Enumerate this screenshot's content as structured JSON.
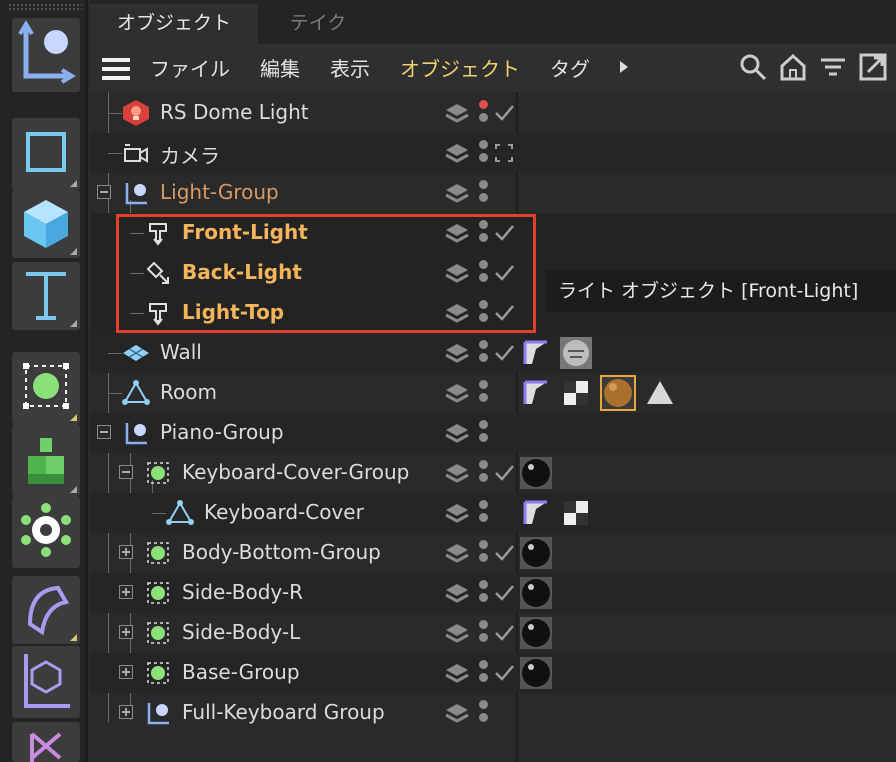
{
  "tabs": {
    "objects": "オブジェクト",
    "takes": "テイク"
  },
  "menu": {
    "file": "ファイル",
    "edit": "編集",
    "view": "表示",
    "object": "オブジェクト",
    "tag": "タグ"
  },
  "objects": [
    {
      "name": "RS Dome Light",
      "icon": "dome-light-icon"
    },
    {
      "name": "カメラ",
      "icon": "camera-icon"
    },
    {
      "name": "Light-Group",
      "icon": "null-group-icon"
    },
    {
      "name": "Front-Light",
      "icon": "spot-light-icon"
    },
    {
      "name": "Back-Light",
      "icon": "area-light-icon"
    },
    {
      "name": "Light-Top",
      "icon": "spot-light-icon"
    },
    {
      "name": "Wall",
      "icon": "plane-icon"
    },
    {
      "name": "Room",
      "icon": "polygon-icon"
    },
    {
      "name": "Piano-Group",
      "icon": "null-group-icon"
    },
    {
      "name": "Keyboard-Cover-Group",
      "icon": "connect-icon"
    },
    {
      "name": "Keyboard-Cover",
      "icon": "polygon-icon"
    },
    {
      "name": "Body-Bottom-Group",
      "icon": "connect-icon"
    },
    {
      "name": "Side-Body-R",
      "icon": "connect-icon"
    },
    {
      "name": "Side-Body-L",
      "icon": "connect-icon"
    },
    {
      "name": "Base-Group",
      "icon": "connect-icon"
    },
    {
      "name": "Full-Keyboard Group",
      "icon": "null-group-icon"
    }
  ],
  "tooltip": "ライト オブジェクト [Front-Light]",
  "colors": {
    "accent": "#f0d070",
    "highlight": "#e0402c",
    "light_name": "#f3b45a",
    "group_name": "#d89a64"
  }
}
